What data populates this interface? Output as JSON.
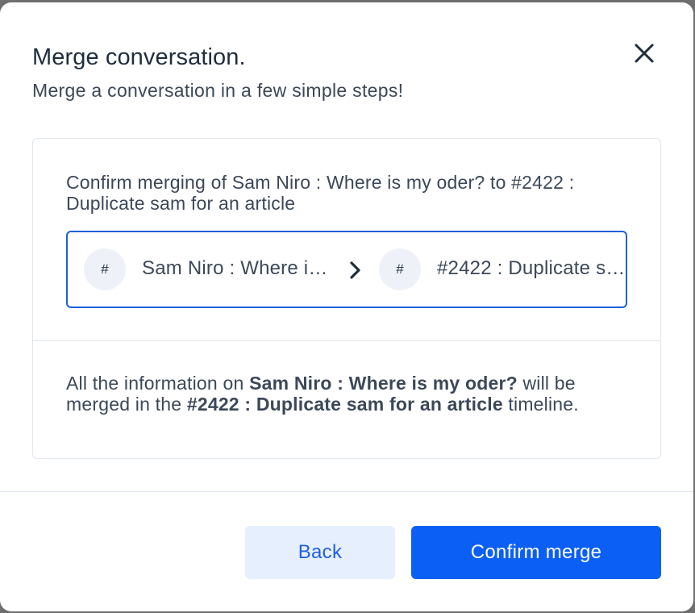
{
  "modal": {
    "title": "Merge conversation.",
    "subtitle": "Merge a conversation in a few simple steps!",
    "close_icon": "close-icon"
  },
  "confirm": {
    "text": "Confirm merging of Sam Niro : Where is my oder? to #2422 : Duplicate sam for an article"
  },
  "selector": {
    "source": {
      "icon": "#",
      "label": "Sam Niro : Where is my oder?"
    },
    "arrow_icon": "chevron-right-icon",
    "target": {
      "icon": "#",
      "label": "#2422 : Duplicate sam for an article"
    }
  },
  "info": {
    "prefix": "All the information on",
    "source": "Sam Niro : Where is my oder?",
    "middle": "will be merged in the",
    "target": "#2422 : Duplicate sam for an article",
    "suffix": "timeline."
  },
  "footer": {
    "back_label": "Back",
    "confirm_label": "Confirm merge"
  },
  "colors": {
    "primary": "#0b5ff5",
    "secondary_bg": "#e6effd",
    "text": "#3c4858",
    "heading": "#1f2d3d",
    "border": "#e0e6ed"
  }
}
